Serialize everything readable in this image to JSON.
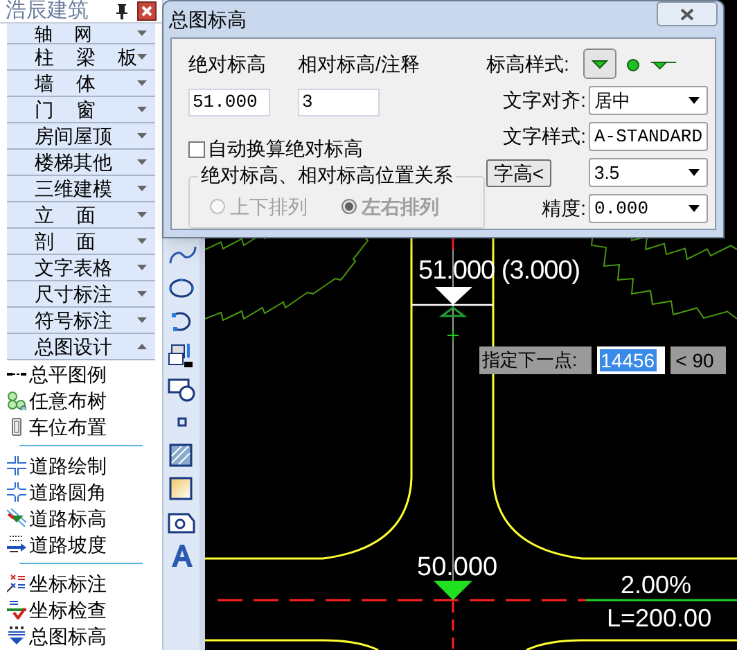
{
  "panel": {
    "title": "浩辰建筑",
    "menu": [
      {
        "label": "轴 网",
        "expanded": false
      },
      {
        "label": "柱 梁 板",
        "expanded": false
      },
      {
        "label": "墙 体",
        "expanded": false
      },
      {
        "label": "门 窗",
        "expanded": false
      },
      {
        "label": "房间屋顶",
        "expanded": false
      },
      {
        "label": "楼梯其他",
        "expanded": false
      },
      {
        "label": "三维建模",
        "expanded": false
      },
      {
        "label": "立 面",
        "expanded": false
      },
      {
        "label": "剖 面",
        "expanded": false
      },
      {
        "label": "文字表格",
        "expanded": false
      },
      {
        "label": "尺寸标注",
        "expanded": false
      },
      {
        "label": "符号标注",
        "expanded": false
      },
      {
        "label": "总图设计",
        "expanded": true
      }
    ],
    "tool_groups": [
      [
        "总平图例",
        "任意布树",
        "车位布置"
      ],
      [
        "道路绘制",
        "道路圆角",
        "道路标高",
        "道路坡度"
      ],
      [
        "坐标标注",
        "坐标检查",
        "总图标高"
      ]
    ]
  },
  "dialog": {
    "title": "总图标高",
    "absolute_label": "绝对标高",
    "absolute_value": "51.000",
    "relative_label": "相对标高/注释",
    "relative_value": "3",
    "auto_convert": {
      "label": "自动换算绝对标高",
      "checked": false
    },
    "position_group": {
      "legend": "绝对标高、相对标高位置关系",
      "options": [
        {
          "label": "上下排列",
          "selected": false,
          "disabled": true
        },
        {
          "label": "左右排列",
          "selected": true,
          "disabled": true
        }
      ]
    },
    "style_label": "标高样式:",
    "styles": [
      {
        "kind": "triangle",
        "selected": true
      },
      {
        "kind": "dot",
        "selected": false
      },
      {
        "kind": "flag",
        "selected": false
      }
    ],
    "align": {
      "label": "文字对齐:",
      "value": "居中"
    },
    "text_style": {
      "label": "文字样式:",
      "value": "A-STANDARD"
    },
    "height_button": "字高<",
    "height_value": "3.5",
    "precision": {
      "label": "精度:",
      "value": "0.000"
    }
  },
  "canvas": {
    "marker_text": "51.000 (3.000)",
    "elevation_text": "50.000",
    "slope": "2.00%",
    "length": "L=200.00"
  },
  "command": {
    "prompt": "指定下一点:",
    "value": "14456",
    "angle": "< 90"
  }
}
